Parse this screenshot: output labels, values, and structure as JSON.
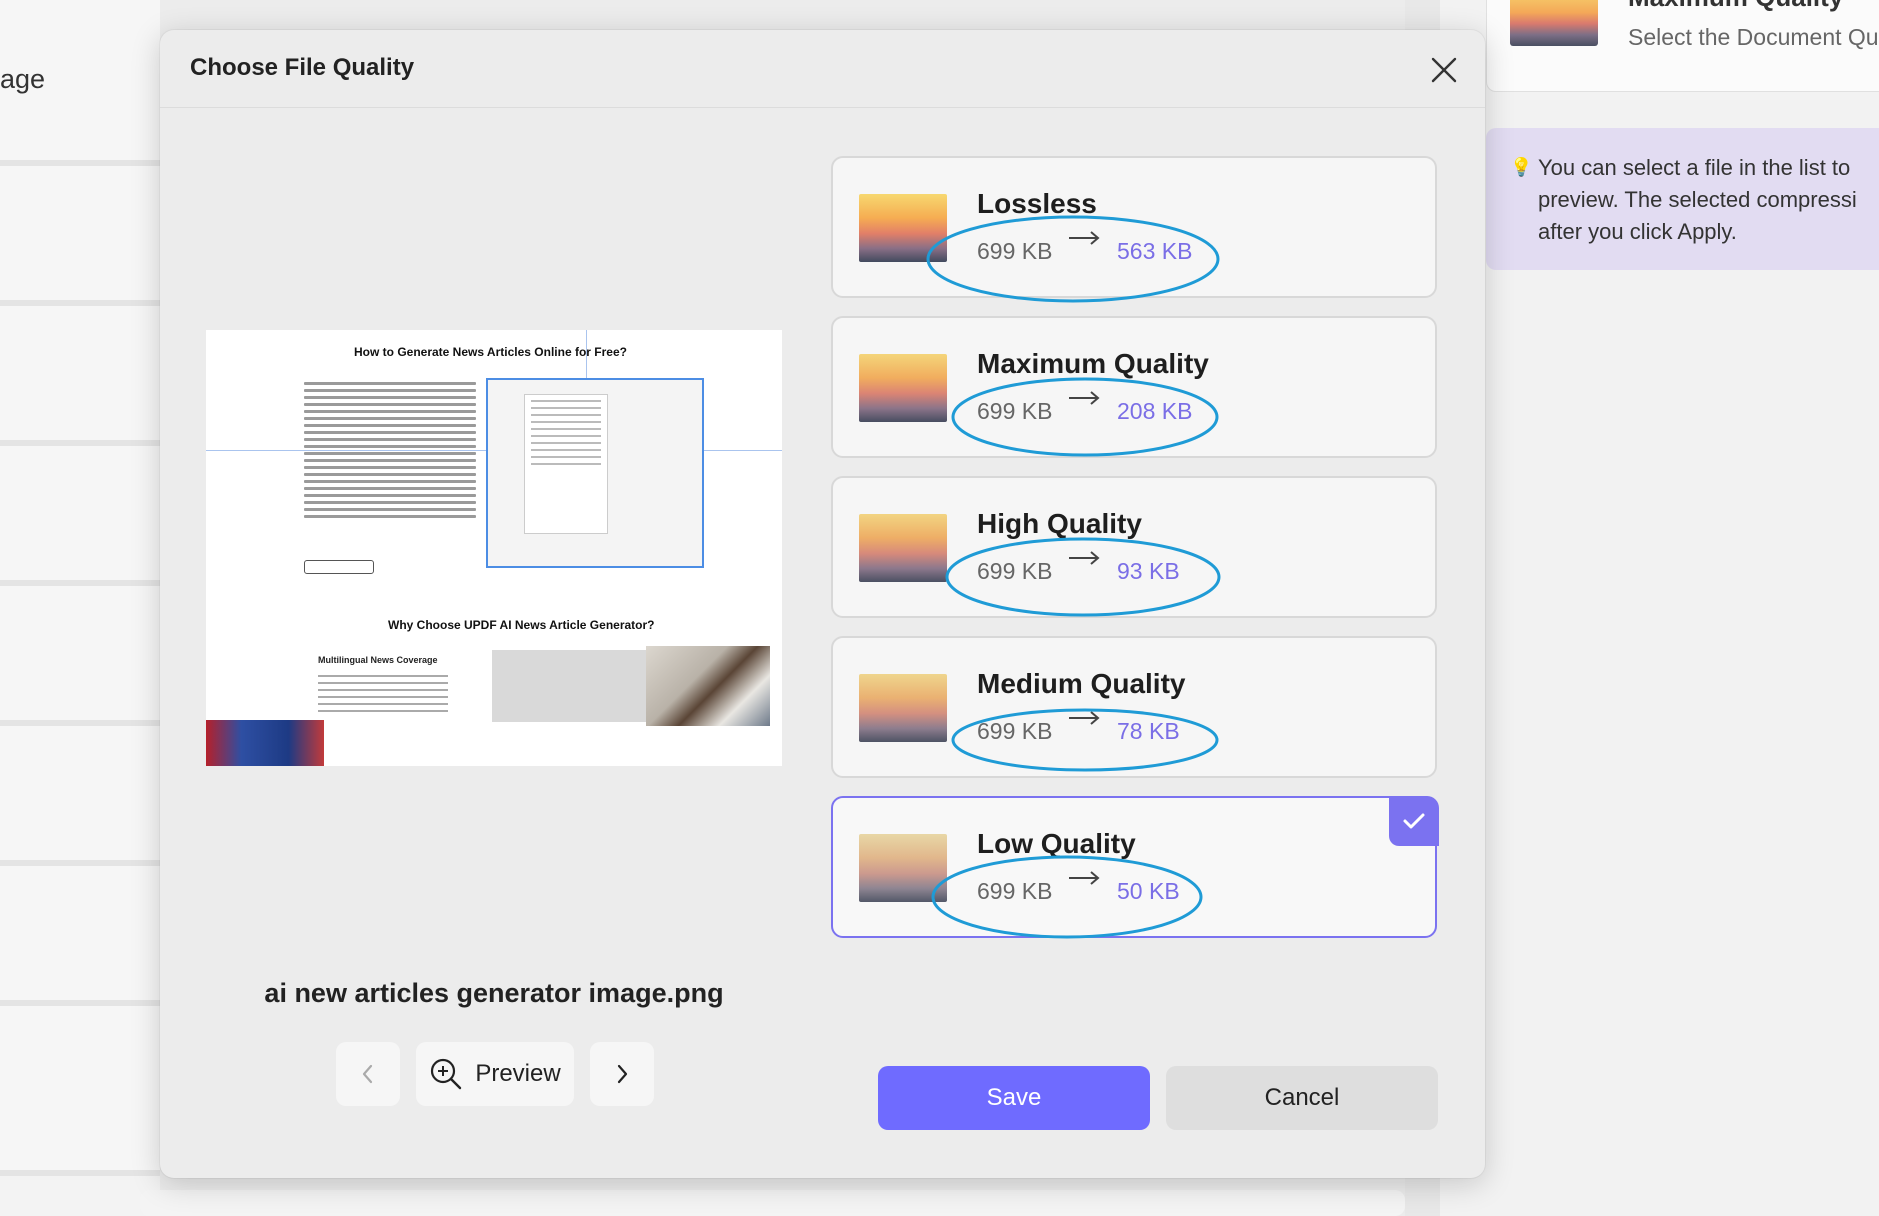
{
  "background": {
    "left_label": "age",
    "right_card_title": "Maximum Quality",
    "right_card_subtitle": "Select the Document Qu",
    "tip_text": "You can select a file in the list to\npreview. The selected compressi\nafter you click Apply.",
    "tip_icon": "lightbulb-icon"
  },
  "dialog": {
    "title": "Choose File Quality",
    "close_icon": "close-icon",
    "filename": "ai new articles generator image.png",
    "preview_label": "Preview",
    "preview_heading": "How to Generate News Articles Online for Free?",
    "preview_heading2": "Why Choose UPDF AI News Article Generator?",
    "preview_subheading": "Multilingual News Coverage",
    "options": [
      {
        "title": "Lossless",
        "original": "699 KB",
        "compressed": "563 KB",
        "selected": false
      },
      {
        "title": "Maximum Quality",
        "original": "699 KB",
        "compressed": "208 KB",
        "selected": false
      },
      {
        "title": "High Quality",
        "original": "699 KB",
        "compressed": "93 KB",
        "selected": false
      },
      {
        "title": "Medium Quality",
        "original": "699 KB",
        "compressed": "78 KB",
        "selected": false
      },
      {
        "title": "Low Quality",
        "original": "699 KB",
        "compressed": "50 KB",
        "selected": true
      }
    ],
    "save_label": "Save",
    "cancel_label": "Cancel"
  },
  "colors": {
    "accent": "#6f6bff",
    "compressed_text": "#7a6ee6",
    "annotation_circle": "#1f9bd6"
  }
}
